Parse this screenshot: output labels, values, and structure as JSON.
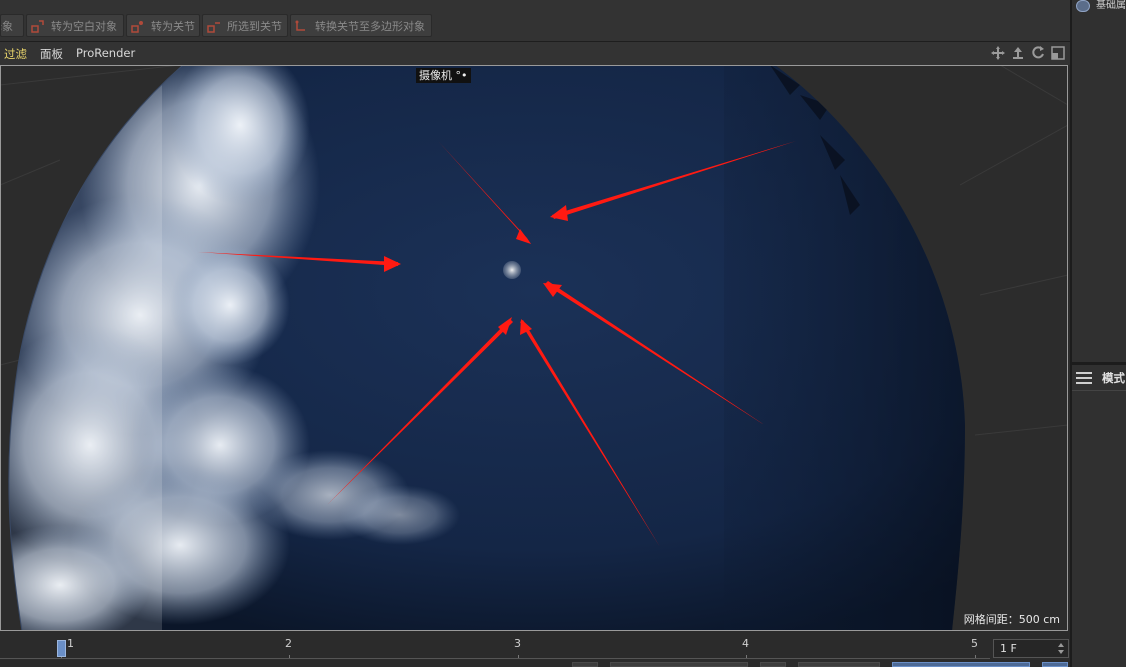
{
  "toolbar": {
    "buttons": [
      {
        "label": "择象"
      },
      {
        "label": "转为空白对象"
      },
      {
        "label": "转为关节"
      },
      {
        "label": "所选到关节"
      },
      {
        "label": "转换关节至多边形对象"
      }
    ]
  },
  "viewport_menu": {
    "items": [
      "过滤",
      "面板",
      "ProRender"
    ]
  },
  "viewport": {
    "camera_label": "摄像机",
    "grid_spacing": "网格间距：500 cm"
  },
  "right_panel": {
    "top_label": "基础属",
    "mode_label": "模式"
  },
  "timeline": {
    "ticks": [
      "1",
      "2",
      "3",
      "4",
      "5"
    ],
    "frame_value": "1 F"
  },
  "colors": {
    "accent_active_menu": "#e9d56b",
    "arrow_red": "#ff1a12",
    "sphere_dark_blue": "#142848",
    "playhead_blue": "#6a8fc7"
  },
  "icons": [
    "move-icon",
    "vertical-move-icon",
    "rotate-icon",
    "maximize-icon",
    "menu-icon"
  ]
}
